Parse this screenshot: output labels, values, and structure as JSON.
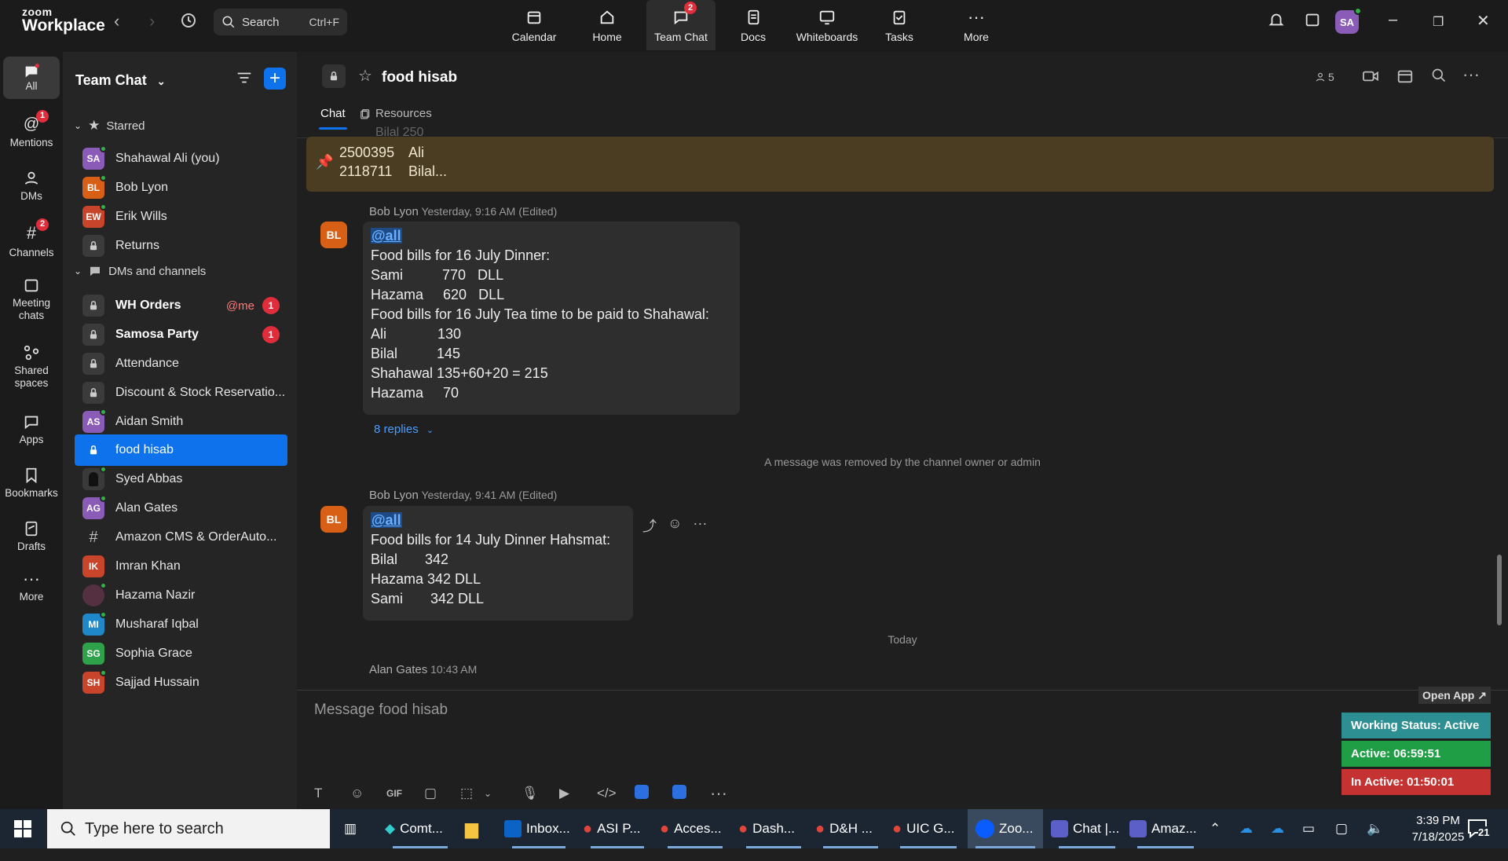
{
  "topbar": {
    "logo_top": "zoom",
    "logo_bottom": "Workplace",
    "search_label": "Search",
    "search_shortcut": "Ctrl+F",
    "nav": [
      {
        "label": "Calendar"
      },
      {
        "label": "Home"
      },
      {
        "label": "Team Chat",
        "badge": "2"
      },
      {
        "label": "Docs"
      },
      {
        "label": "Whiteboards"
      },
      {
        "label": "Tasks"
      },
      {
        "label": "More"
      }
    ],
    "avatar": "SA"
  },
  "rail": [
    {
      "label": "All"
    },
    {
      "label": "Mentions",
      "badge": "1"
    },
    {
      "label": "DMs"
    },
    {
      "label": "Channels",
      "badge": "2"
    },
    {
      "label": "Meeting chats"
    },
    {
      "label": "Shared spaces"
    },
    {
      "label": "Apps"
    },
    {
      "label": "Bookmarks"
    },
    {
      "label": "Drafts"
    },
    {
      "label": "More"
    }
  ],
  "sidebar": {
    "title": "Team Chat",
    "starred_label": "Starred",
    "dms_label": "DMs and channels",
    "starred": [
      {
        "initials": "SA",
        "name": "Shahawal Ali (you)",
        "color": "#8b5bb8"
      },
      {
        "initials": "BL",
        "name": "Bob Lyon",
        "color": "#d86016"
      },
      {
        "initials": "EW",
        "name": "Erik Wills",
        "color": "#c8452c"
      },
      {
        "initials": "",
        "name": "Returns",
        "color": "lock"
      }
    ],
    "channels": [
      {
        "name": "WH Orders",
        "mention": "@me",
        "badge": "1"
      },
      {
        "name": "Samosa Party",
        "badge": "1"
      },
      {
        "name": "Attendance"
      },
      {
        "name": "Discount & Stock Reservatio..."
      },
      {
        "initials": "AS",
        "name": "Aidan Smith",
        "color": "#8b5bb8"
      },
      {
        "name": "food hisab"
      },
      {
        "initials": "",
        "name": "Syed Abbas",
        "color": "#444"
      },
      {
        "initials": "AG",
        "name": "Alan Gates",
        "color": "#8b5bb8"
      },
      {
        "name": "Amazon CMS & OrderAuto..."
      },
      {
        "initials": "IK",
        "name": "Imran Khan",
        "color": "#c8452c"
      },
      {
        "initials": "",
        "name": "Hazama Nazir",
        "color": "#553040"
      },
      {
        "initials": "MI",
        "name": "Musharaf Iqbal",
        "color": "#1e88c8"
      },
      {
        "initials": "SG",
        "name": "Sophia Grace",
        "color": "#2fa14a"
      },
      {
        "initials": "SH",
        "name": "Sajjad Hussain",
        "color": "#c8452c"
      }
    ]
  },
  "channel": {
    "name": "food hisab",
    "member_count": "5",
    "tab_chat": "Chat",
    "tab_resources": "Resources",
    "pinned_line1_id": "2500395",
    "pinned_line1_name": "Ali",
    "pinned_line2_id": "2118711",
    "pinned_line2_name": "Bilal...",
    "cut_text": "Bilal     250"
  },
  "messages": {
    "m1": {
      "author": "Bob Lyon",
      "time": "Yesterday, 9:16 AM (Edited)",
      "initials": "BL",
      "mention": "@all",
      "lines": [
        "Food bills for 16 July Dinner:",
        "Sami          770   DLL",
        "Hazama     620   DLL",
        "Food bills for 16 July Tea time to be paid to Shahawal:",
        "Ali             130",
        "Bilal          145",
        "Shahawal 135+60+20 = 215",
        "Hazama     70"
      ],
      "replies": "8 replies"
    },
    "removed": "A message was removed by the channel owner or admin",
    "m2": {
      "author": "Bob Lyon",
      "time": "Yesterday, 9:41 AM (Edited)",
      "initials": "BL",
      "mention": "@all",
      "lines": [
        "Food bills for 14 July Dinner Hahsmat:",
        "Bilal       342",
        "Hazama 342 DLL",
        "Sami       342 DLL"
      ]
    },
    "today": "Today",
    "m3_author": "Alan Gates",
    "m3_time": "10:43 AM"
  },
  "composer": {
    "placeholder": "Message food hisab",
    "gif": "GIF"
  },
  "widget": {
    "open_app": "Open App ↗",
    "working": "Working Status: Active",
    "active": "Active: 06:59:51",
    "inactive": "In Active: 01:50:01"
  },
  "taskbar": {
    "search": "Type here to search",
    "apps": [
      "Comt...",
      "",
      "Inbox...",
      "ASI P...",
      "Acces...",
      "Dash...",
      "D&H ...",
      "UIC G...",
      "Zoo...",
      "Chat |...",
      "Amaz..."
    ],
    "time": "3:39 PM",
    "date": "7/18/2025",
    "notif": "21"
  },
  "colors": {
    "accent": "#0e72ed",
    "badge": "#e02d3c",
    "pinned_bg": "#4a3d22",
    "status_green": "#1f9e45",
    "status_red": "#c53232",
    "status_teal": "#2e8f92"
  }
}
